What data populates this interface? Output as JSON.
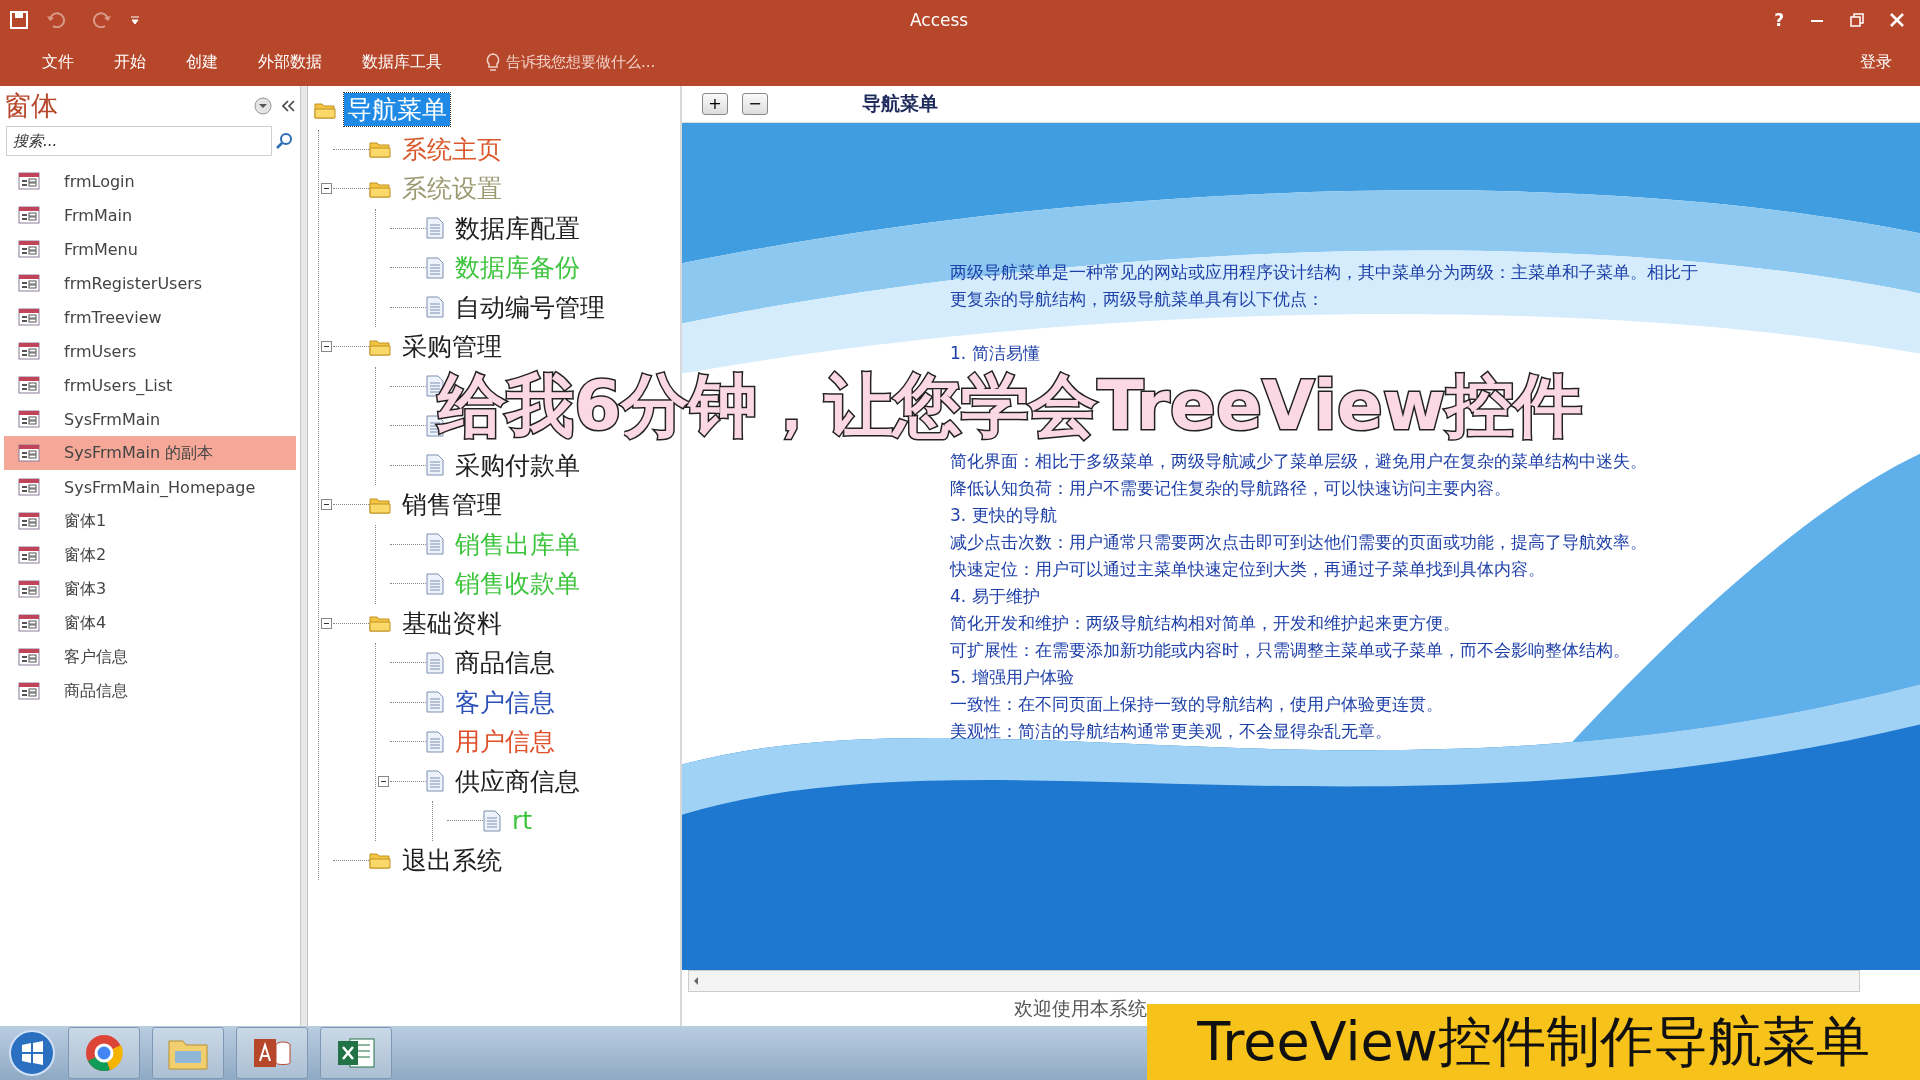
{
  "window": {
    "title": "Access",
    "help": "?"
  },
  "ribbon": {
    "tabs": [
      "文件",
      "开始",
      "创建",
      "外部数据",
      "数据库工具"
    ],
    "tell_me": "告诉我您想要做什么...",
    "sign_in": "登录"
  },
  "nav_pane": {
    "title": "窗体",
    "search": {
      "placeholder": "搜索..."
    },
    "items": [
      {
        "label": "frmLogin",
        "selected": false
      },
      {
        "label": "FrmMain",
        "selected": false
      },
      {
        "label": "FrmMenu",
        "selected": false
      },
      {
        "label": "frmRegisterUsers",
        "selected": false
      },
      {
        "label": "frmTreeview",
        "selected": false
      },
      {
        "label": "frmUsers",
        "selected": false
      },
      {
        "label": "frmUsers_List",
        "selected": false
      },
      {
        "label": "SysFrmMain",
        "selected": false
      },
      {
        "label": "SysFrmMain 的副本",
        "selected": true
      },
      {
        "label": "SysFrmMain_Homepage",
        "selected": false
      },
      {
        "label": "窗体1",
        "selected": false
      },
      {
        "label": "窗体2",
        "selected": false
      },
      {
        "label": "窗体3",
        "selected": false
      },
      {
        "label": "窗体4",
        "selected": false
      },
      {
        "label": "客户信息",
        "selected": false
      },
      {
        "label": "商品信息",
        "selected": false
      }
    ]
  },
  "tree": {
    "label": "导航菜单",
    "kind": "folder",
    "selected": true,
    "children": [
      {
        "label": "系统主页",
        "kind": "folder",
        "selected": false,
        "color": "#d9582c"
      },
      {
        "label": "系统设置",
        "kind": "folder",
        "selected": false,
        "color": "#9c9a72",
        "expanded": true,
        "children": [
          {
            "label": "数据库配置",
            "kind": "page",
            "selected": false,
            "color": "#202020"
          },
          {
            "label": "数据库备份",
            "kind": "page",
            "selected": false,
            "color": "#3cc43c"
          },
          {
            "label": "自动编号管理",
            "kind": "page",
            "selected": false,
            "color": "#202020"
          }
        ]
      },
      {
        "label": "采购管理",
        "kind": "folder",
        "selected": false,
        "color": "#202020",
        "expanded": true,
        "children": [
          {
            "kind": "page"
          },
          {
            "kind": "page"
          },
          {
            "label": "采购付款单",
            "kind": "page",
            "selected": false,
            "color": "#202020"
          }
        ]
      },
      {
        "label": "销售管理",
        "kind": "folder",
        "selected": false,
        "color": "#202020",
        "expanded": true,
        "children": [
          {
            "label": "销售出库单",
            "kind": "page",
            "selected": false,
            "color": "#3cc43c"
          },
          {
            "label": "销售收款单",
            "kind": "page",
            "selected": false,
            "color": "#3cc43c"
          }
        ]
      },
      {
        "label": "基础资料",
        "kind": "folder",
        "selected": false,
        "color": "#202020",
        "expanded": true,
        "children": [
          {
            "label": "商品信息",
            "kind": "page",
            "selected": false,
            "color": "#202020"
          },
          {
            "label": "客户信息",
            "kind": "page",
            "selected": false,
            "color": "#2c4fb8"
          },
          {
            "label": "用户信息",
            "kind": "page",
            "selected": false,
            "color": "#e0502a"
          },
          {
            "label": "供应商信息",
            "kind": "page",
            "selected": false,
            "color": "#202020",
            "expanded": true,
            "children": [
              {
                "label": "rt",
                "kind": "page",
                "selected": false,
                "color": "#3cc43c"
              }
            ]
          }
        ]
      },
      {
        "label": "退出系统",
        "kind": "folder",
        "selected": false,
        "color": "#202020"
      }
    ]
  },
  "form": {
    "zoom_buttons": [
      "+",
      "−"
    ],
    "title": "导航菜单",
    "lines": [
      {
        "kind": "text",
        "text": "两级导航菜单是一种常见的网站或应用程序设计结构，其中菜单分为两级：主菜单和子菜单。相比于"
      },
      {
        "kind": "text",
        "text": "更复杂的导航结构，两级导航菜单具有以下优点："
      },
      {
        "kind": "blank"
      },
      {
        "kind": "text",
        "text": "1. 简洁易懂"
      },
      {
        "kind": "hidden"
      },
      {
        "kind": "hidden"
      },
      {
        "kind": "hidden"
      },
      {
        "kind": "text",
        "text": "简化界面：相比于多级菜单，两级导航减少了菜单层级，避免用户在复杂的菜单结构中迷失。"
      },
      {
        "kind": "text",
        "text": "降低认知负荷：用户不需要记住复杂的导航路径，可以快速访问主要内容。"
      },
      {
        "kind": "text",
        "text": "3. 更快的导航"
      },
      {
        "kind": "text",
        "text": "减少点击次数：用户通常只需要两次点击即可到达他们需要的页面或功能，提高了导航效率。"
      },
      {
        "kind": "text",
        "text": "快速定位：用户可以通过主菜单快速定位到大类，再通过子菜单找到具体内容。"
      },
      {
        "kind": "text",
        "text": "4. 易于维护"
      },
      {
        "kind": "text",
        "text": "简化开发和维护：两级导航结构相对简单，开发和维护起来更方便。"
      },
      {
        "kind": "text",
        "text": "可扩展性：在需要添加新功能或内容时，只需调整主菜单或子菜单，而不会影响整体结构。"
      },
      {
        "kind": "text",
        "text": "5. 增强用户体验"
      },
      {
        "kind": "text",
        "text": "一致性：在不同页面上保持一致的导航结构，使用户体验更连贯。"
      },
      {
        "kind": "text",
        "text": "美观性：简洁的导航结构通常更美观，不会显得杂乱无章。"
      }
    ],
    "footer": "欢迎使用本系统"
  },
  "overlays": {
    "caption": "给我6分钟，让您学会TreeView控件",
    "banner": "TreeView控件制作导航菜单"
  }
}
